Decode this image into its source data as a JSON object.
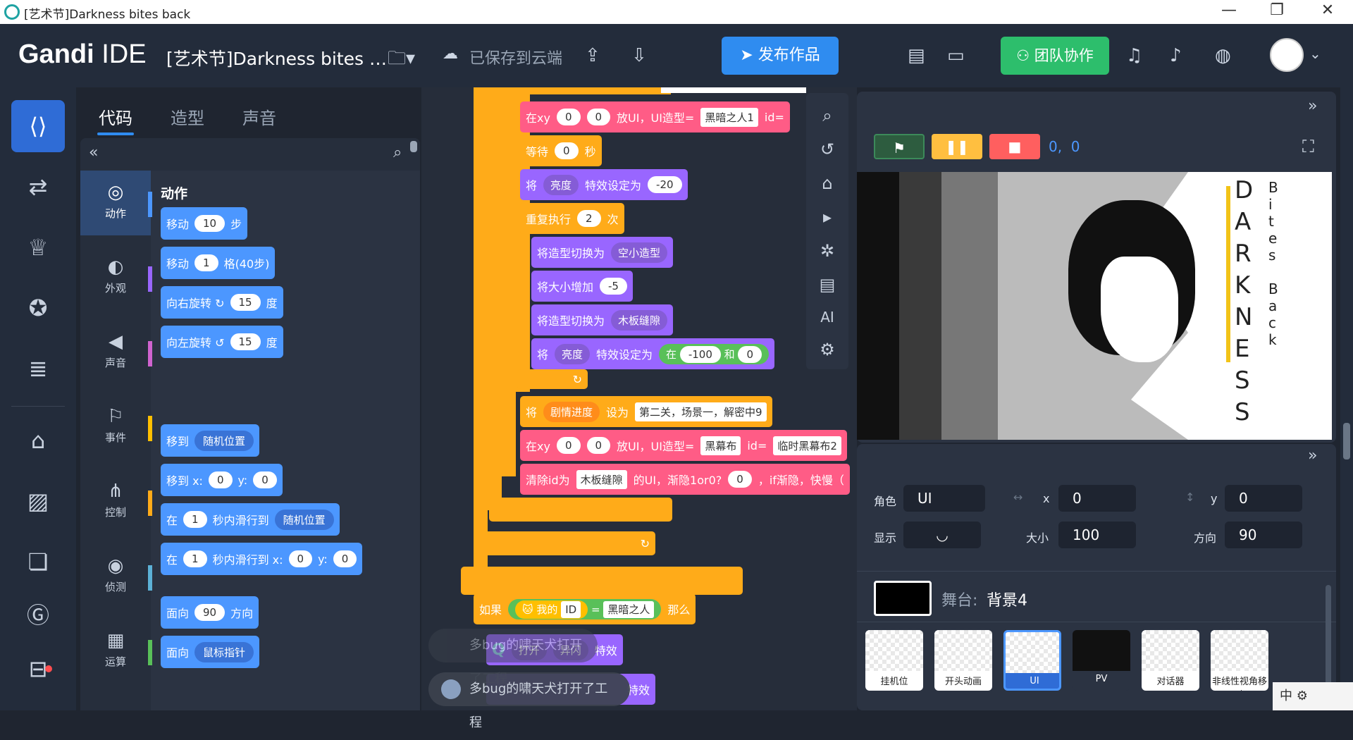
{
  "window": {
    "title": "[艺术节]Darkness bites back",
    "minimize": "—",
    "maximize": "❐",
    "close": "✕"
  },
  "topbar": {
    "brand_bold": "Gandi",
    "brand_light": " IDE",
    "project": "[艺术节]Darkness bites …",
    "saved": "已保存到云端",
    "publish": "发布作品",
    "team": "团队协作"
  },
  "tabs": [
    "代码",
    "造型",
    "声音"
  ],
  "palette": {
    "section": "动作",
    "categories": [
      {
        "label": "动作",
        "color": "#4c97ff"
      },
      {
        "label": "外观",
        "color": "#9966ff"
      },
      {
        "label": "声音",
        "color": "#cf63cf"
      },
      {
        "label": "事件",
        "color": "#ffbf00"
      },
      {
        "label": "控制",
        "color": "#ffab19"
      },
      {
        "label": "侦测",
        "color": "#5cb1d6"
      },
      {
        "label": "运算",
        "color": "#59c059"
      }
    ],
    "blocks": [
      {
        "t": [
          "移动"
        ],
        "v": "10",
        "s": "步"
      },
      {
        "t": [
          "移动"
        ],
        "v": "1",
        "s": "格(40步)"
      },
      {
        "t": [
          "向右旋转 ↻"
        ],
        "v": "15",
        "s": "度"
      },
      {
        "t": [
          "向左旋转 ↺"
        ],
        "v": "15",
        "s": "度"
      }
    ],
    "goto": "移到",
    "goto_dd": "随机位置",
    "gotoxy": "移到 x:",
    "x0": "0",
    "y_lbl": "y:",
    "y0": "0",
    "glide_in": "在",
    "glide_v": "1",
    "glide_to": "秒内滑行到",
    "glide_dd": "随机位置",
    "glidexy_to": "秒内滑行到 x:",
    "face": "面向",
    "face_v": "90",
    "face_s": "方向",
    "face2": "面向",
    "face2_dd": "鼠标指针"
  },
  "canvas": {
    "b1": {
      "a": "在xy",
      "x": "0",
      "y": "0",
      "b": "放UI，UI造型=",
      "c": "黑暗之人1",
      "d": "id="
    },
    "b2": {
      "a": "等待",
      "v": "0",
      "s": "秒"
    },
    "b3": {
      "a": "将",
      "dd": "亮度",
      "b": "特效设定为",
      "v": "-20"
    },
    "b4": {
      "a": "重复执行",
      "v": "2",
      "s": "次"
    },
    "b5": {
      "a": "将造型切换为",
      "dd": "空小造型"
    },
    "b6": {
      "a": "将大小增加",
      "v": "-5"
    },
    "b7": {
      "a": "将造型切换为",
      "dd": "木板缝隙"
    },
    "b8": {
      "a": "将",
      "dd": "亮度",
      "b": "特效设定为",
      "c": "在",
      "v1": "-100",
      "and": "和",
      "v2": "0"
    },
    "b9": {
      "a": "将",
      "dd": "剧情进度",
      "b": "设为",
      "v": "第二关，场景一，解密中9"
    },
    "b10": {
      "a": "在xy",
      "x": "0",
      "y": "0",
      "b": "放UI，UI造型=",
      "c": "黑幕布",
      "d": "id=",
      "e": "临时黑幕布2"
    },
    "b11": {
      "a": "清除id为",
      "v": "木板缝隙",
      "b": "的UI，渐隐1or0?",
      "v2": "0",
      "c": "，if渐隐，快慢（"
    },
    "b12": {
      "a": "如果",
      "b": "我的",
      "c": "ID",
      "eq": "=",
      "v": "黑暗之人",
      "d": "那么"
    },
    "b13": {
      "dd1": "打开",
      "dd2": "异闪",
      "s": "特效"
    },
    "b14": {
      "s": "特效"
    }
  },
  "toasts": [
    "多bug的啸天犬打开了工程",
    "多bug的啸天犬打开了工程"
  ],
  "stage": {
    "coords": "0,  0",
    "title_letters": [
      "D",
      "A",
      "R",
      "K",
      "N",
      "E",
      "S",
      "S"
    ],
    "sub_letters": [
      "B",
      "i",
      "t",
      "e",
      "s",
      "",
      "B",
      "a",
      "c",
      "k"
    ]
  },
  "sprite": {
    "role_lbl": "角色",
    "role": "UI",
    "x_lbl": "x",
    "x": "0",
    "y_lbl": "y",
    "y": "0",
    "show_lbl": "显示",
    "size_lbl": "大小",
    "size": "100",
    "dir_lbl": "方向",
    "dir": "90",
    "stage_lbl": "舞台:",
    "stage_name": "背景4",
    "thumbs": [
      "挂机位",
      "开头动画",
      "UI",
      "PV",
      "对话器",
      "非线性视角移动"
    ]
  },
  "ime": "中"
}
